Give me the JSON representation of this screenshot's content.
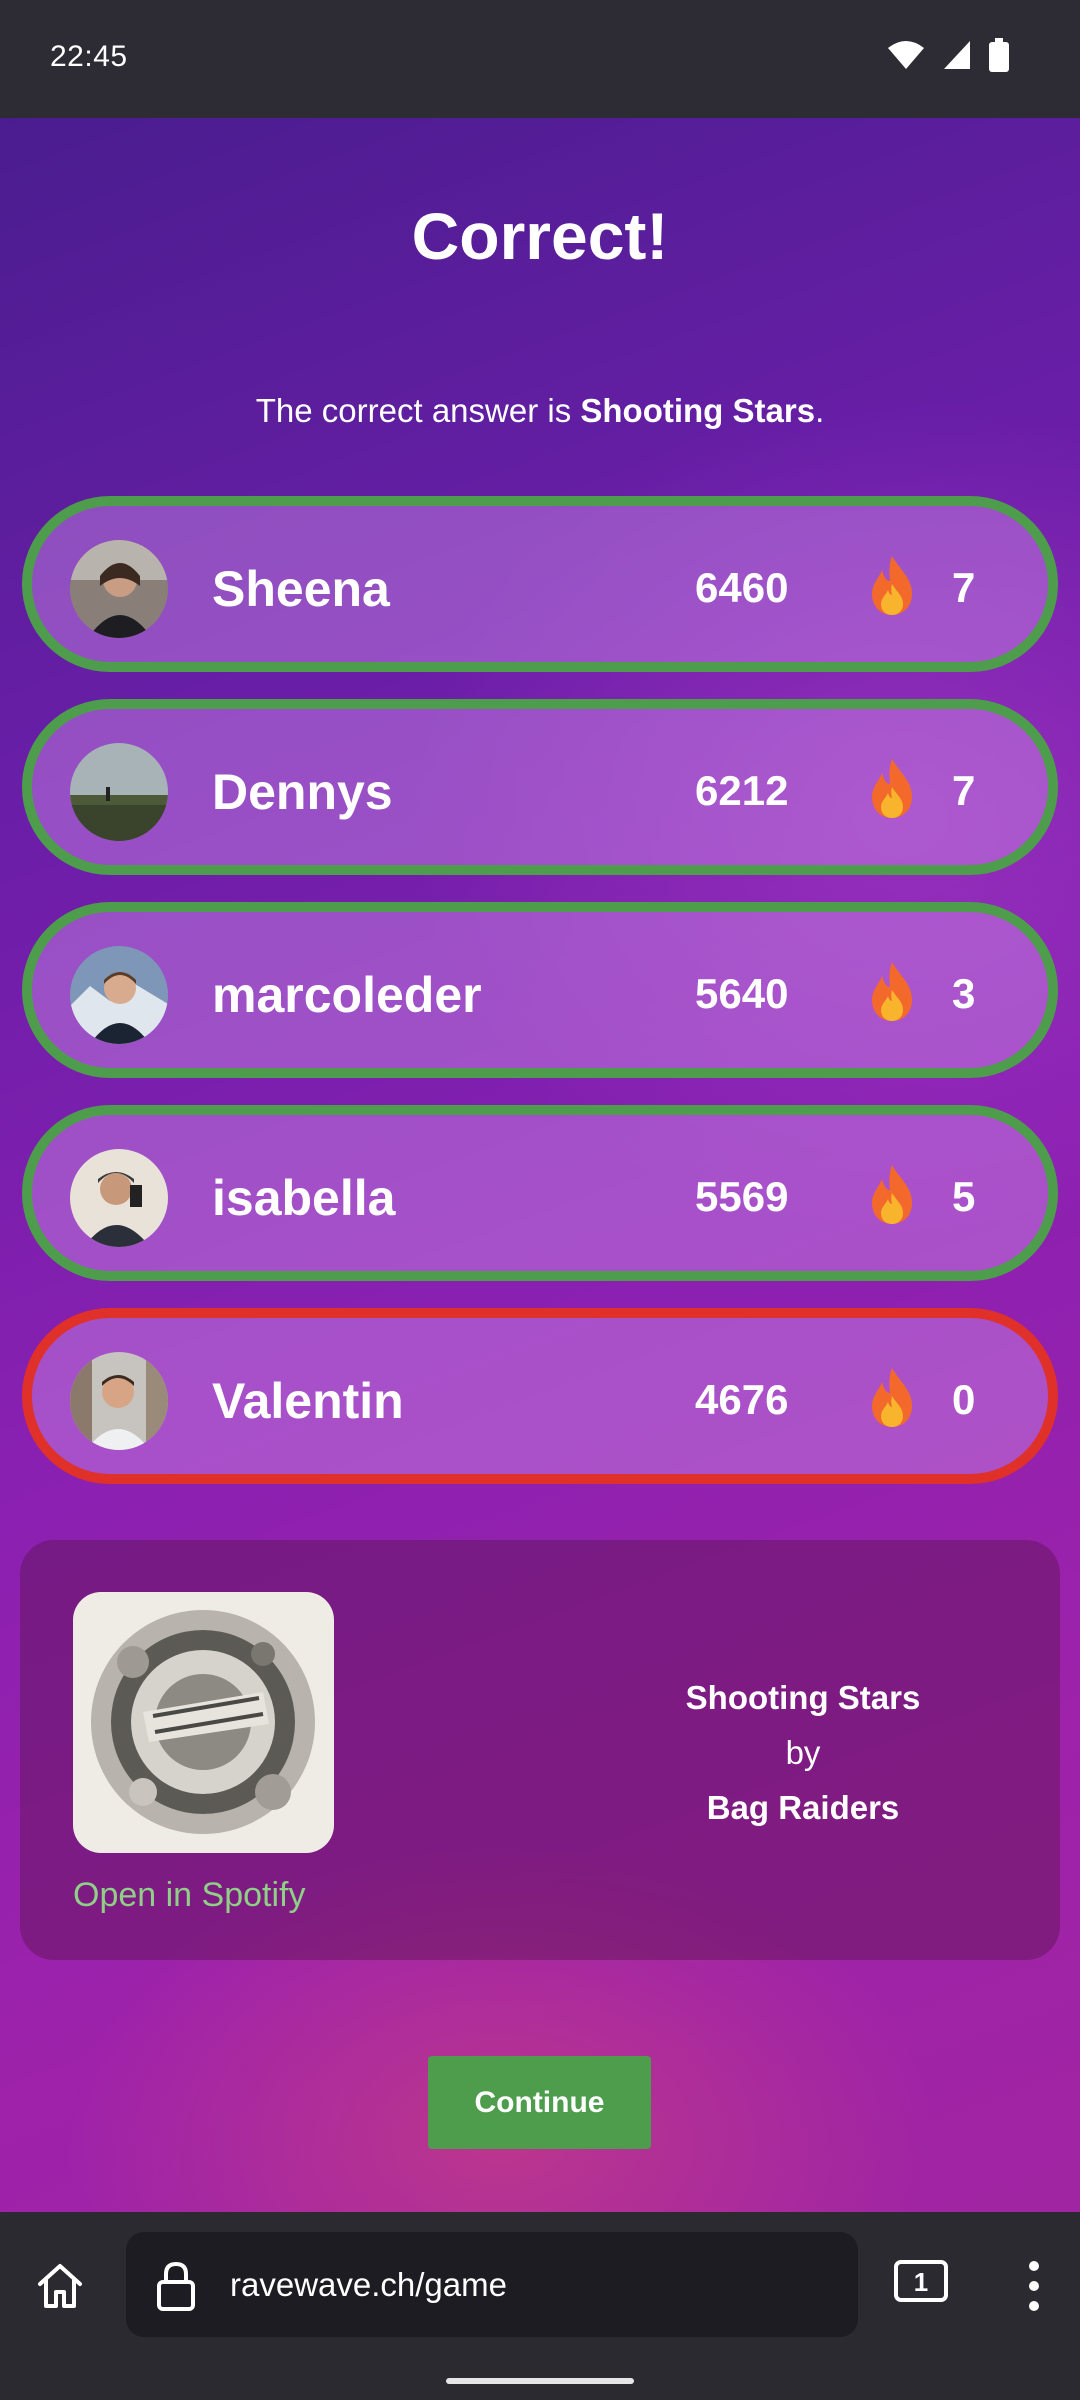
{
  "status_bar": {
    "time": "22:45"
  },
  "game": {
    "title": "Correct!",
    "answer_prefix": "The correct answer is",
    "answer_song": "Shooting Stars",
    "answer_suffix": ".",
    "players": [
      {
        "name": "Sheena",
        "score": "6460",
        "streak": "7",
        "correct": true
      },
      {
        "name": "Dennys",
        "score": "6212",
        "streak": "7",
        "correct": true
      },
      {
        "name": "marcoleder",
        "score": "5640",
        "streak": "3",
        "correct": true
      },
      {
        "name": "isabella",
        "score": "5569",
        "streak": "5",
        "correct": true
      },
      {
        "name": "Valentin",
        "score": "4676",
        "streak": "0",
        "correct": false
      }
    ],
    "song": {
      "title": "Shooting Stars",
      "by": "by",
      "artist": "Bag Raiders",
      "spotify_link": "Open in Spotify"
    },
    "continue_label": "Continue"
  },
  "browser": {
    "url": "ravewave.ch/game",
    "tab_count": "1"
  },
  "colors": {
    "correct": "#4e9d4c",
    "wrong": "#e0302a",
    "spotify": "#8fcf86"
  },
  "icons": [
    "wifi-icon",
    "signal-icon",
    "battery-icon",
    "flame-icon",
    "home-icon",
    "lock-icon",
    "tabs-icon",
    "more-menu-icon"
  ]
}
